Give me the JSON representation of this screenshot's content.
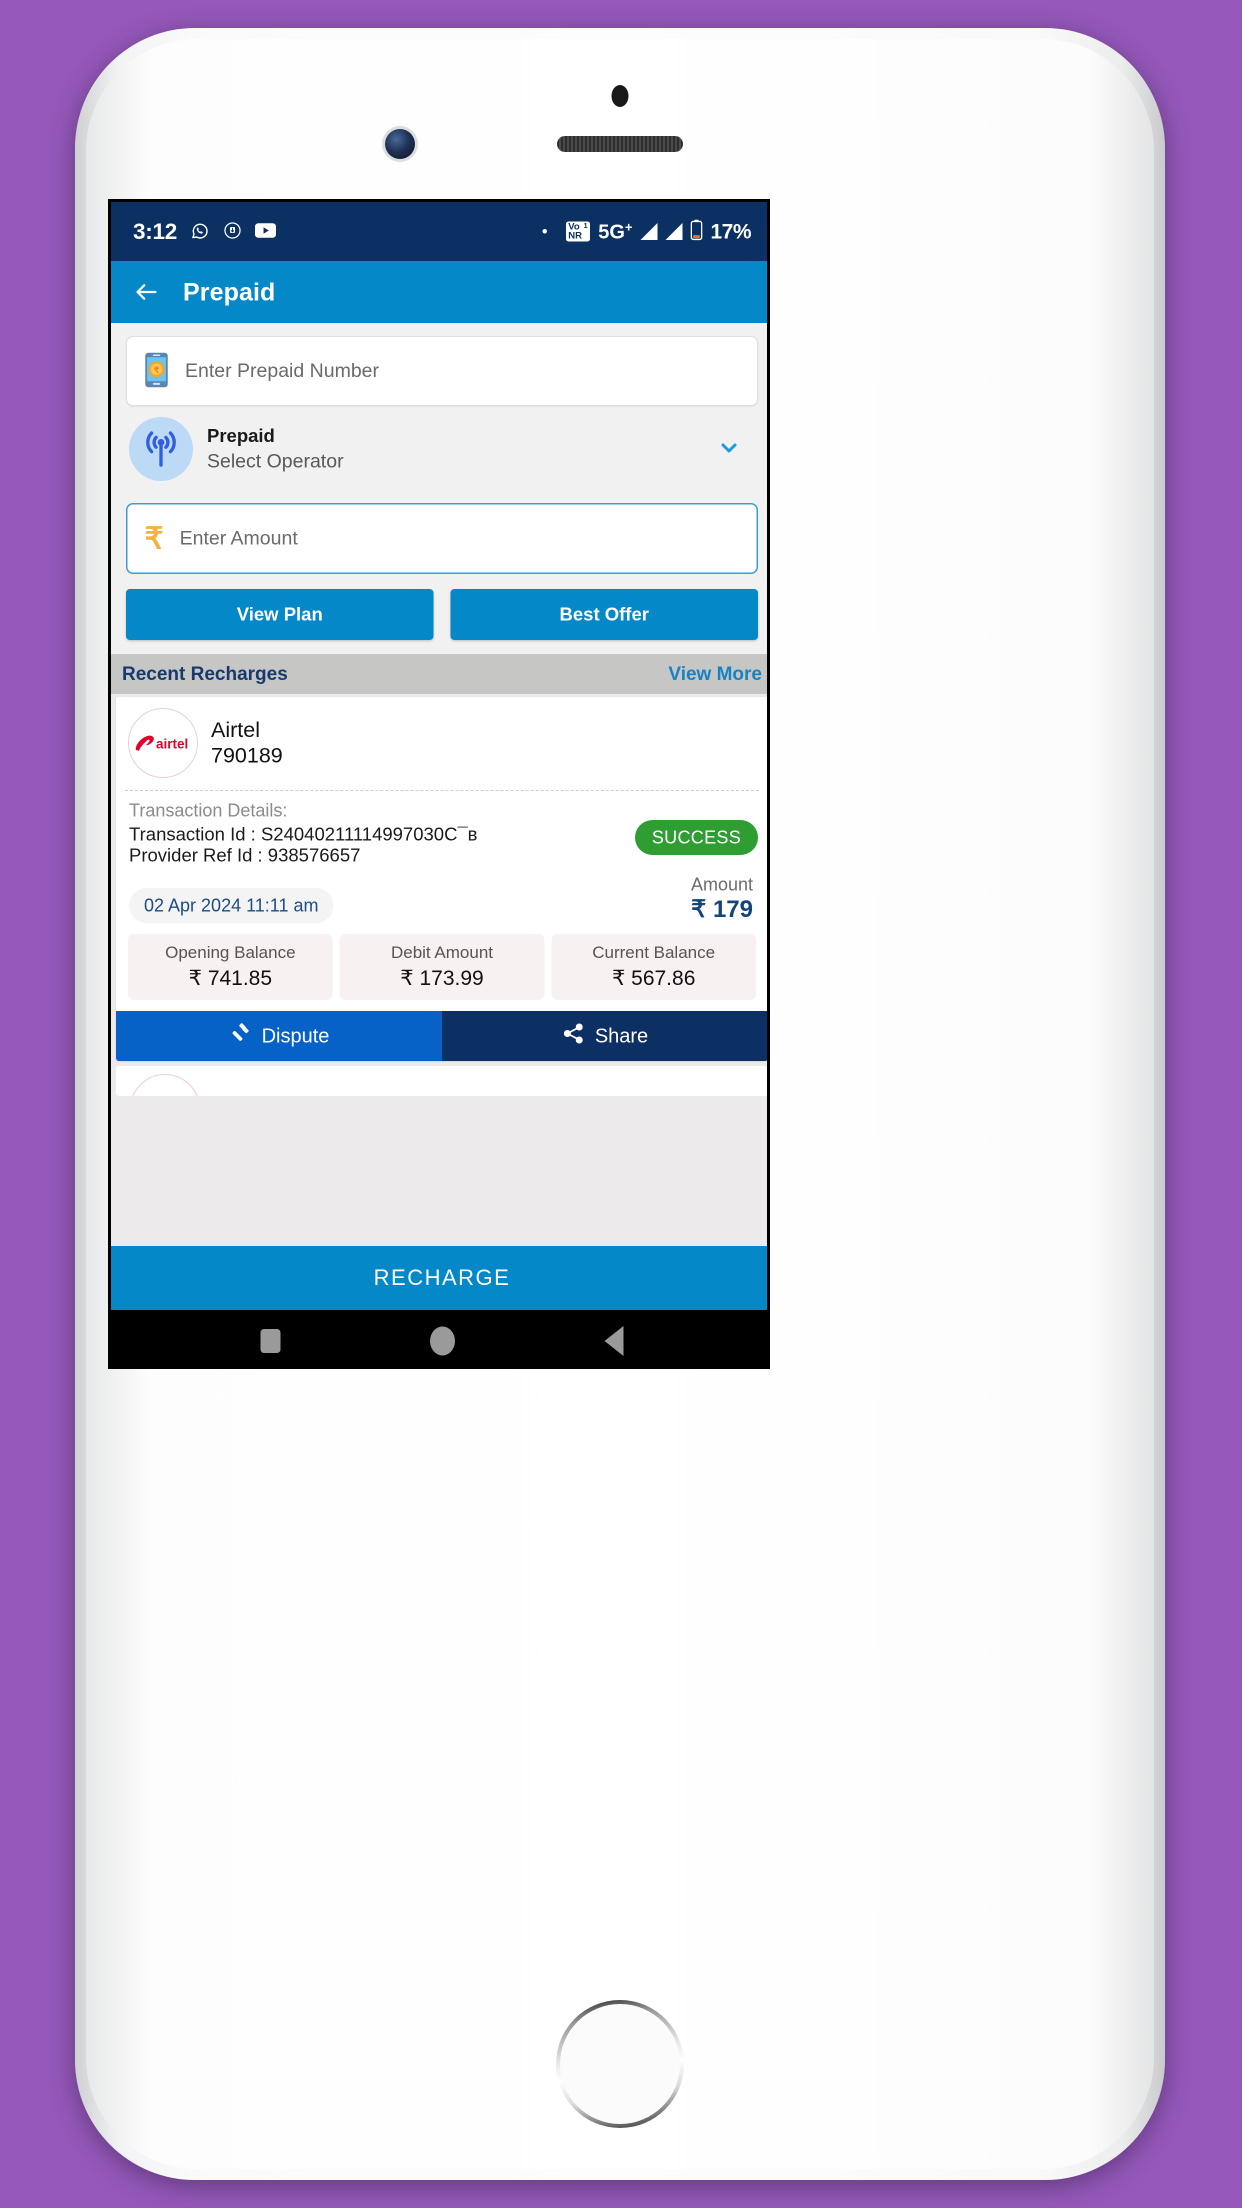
{
  "status_bar": {
    "clock": "3:12",
    "icons": [
      "whatsapp-icon",
      "app-icon",
      "youtube-icon"
    ],
    "dnd": "dnd-dot",
    "vonr_label": "Vo",
    "vonr_label2": "NR",
    "sim_slot": "1",
    "network_type": "5G",
    "network_plus": "+",
    "battery": "17%"
  },
  "app_bar": {
    "back_icon": "arrow-left-icon",
    "title": "Prepaid"
  },
  "form": {
    "number_input": {
      "placeholder": "Enter Prepaid Number",
      "value": "",
      "icon": "mobile-rupee-icon"
    },
    "operator": {
      "icon": "broadcast-antenna-icon",
      "title": "Prepaid",
      "subtitle": "Select Operator",
      "chevron": "chevron-down-icon"
    },
    "amount_input": {
      "placeholder": "Enter Amount",
      "value": "",
      "currency_symbol": "₹"
    },
    "buttons": {
      "view_plan": "View Plan",
      "best_offer": "Best Offer"
    }
  },
  "recent": {
    "heading": "Recent Recharges",
    "view_more": "View More",
    "card": {
      "logo": "airtel-logo",
      "logo_wordmark": "airtel",
      "operator": "Airtel",
      "number": "790189",
      "transaction_details_label": "Transaction Details:",
      "transaction_id_line": "Transaction Id : S24040211114997030C¯ʙ",
      "provider_ref_line": "Provider Ref Id : 938576657",
      "status": "SUCCESS",
      "status_color": "#2e9e32",
      "datetime": "02 Apr 2024 11:11 am",
      "amount_label": "Amount",
      "amount_value": "₹ 179",
      "balances": [
        {
          "label": "Opening Balance",
          "value": "₹ 741.85"
        },
        {
          "label": "Debit Amount",
          "value": "₹ 173.99"
        },
        {
          "label": "Current Balance",
          "value": "₹ 567.86"
        }
      ],
      "dispute_label": "Dispute",
      "dispute_icon": "gavel-icon",
      "share_label": "Share",
      "share_icon": "share-icon"
    }
  },
  "cta": {
    "recharge_label": "RECHARGE"
  },
  "nav_bar": {
    "recents": "square-icon",
    "home": "circle-icon",
    "back": "triangle-back-icon"
  },
  "colors": {
    "background": "#9558bb",
    "status_bar": "#0a3161",
    "app_bar": "#0488c7",
    "accent_blue": "#0488c7",
    "success_green": "#2e9e32",
    "dispute_blue": "#0762c8",
    "share_navy": "#0d3064",
    "airtel_red": "#e4002b"
  }
}
